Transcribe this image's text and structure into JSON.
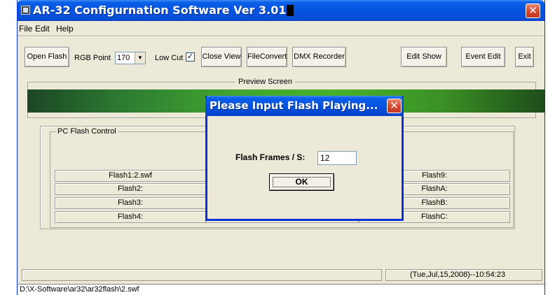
{
  "window": {
    "title": "AR-32 Configurnation Software Ver 3.01",
    "close_glyph": "✕"
  },
  "menu": [
    "File",
    "Edit",
    "Help"
  ],
  "toolbar": {
    "open_flash": "Open Flash",
    "rgb_point_label": "RGB Point",
    "rgb_point_value": "170",
    "low_cut_label": "Low Cut",
    "low_cut_checked": "✓",
    "close_view": "Close View",
    "file_convert": "FileConvert",
    "dmx_recorder": "DMX Recorder",
    "edit_show": "Edit Show",
    "event_edit": "Event Edit",
    "exit": "Exit"
  },
  "preview": {
    "title": "Preview Screen",
    "bar_colors": [
      "#1c4624",
      "#48b02c",
      "#1e4d1a"
    ]
  },
  "pc_flash_control": {
    "title": "PC Flash Control",
    "col1": [
      "Flash1:2.swf",
      "Flash2:",
      "Flash3:",
      "Flash4:"
    ],
    "col3": [
      "Flash9:",
      "FlashA:",
      "FlashB:",
      "FlashC:"
    ]
  },
  "dialog": {
    "title": "Please Input Flash Playing...",
    "close_glyph": "✕",
    "label": "Flash Frames / S:",
    "value": "12",
    "ok": "OK"
  },
  "status": {
    "datetime": "(Tue,Jul,15,2008)--10:54:23",
    "path": "D:\\X-Software\\ar32\\ar32flash\\2.swf"
  },
  "colors": {
    "titlebar": "#0553e0",
    "window_bg": "#ece9d8",
    "close_red": "#d5412b"
  }
}
